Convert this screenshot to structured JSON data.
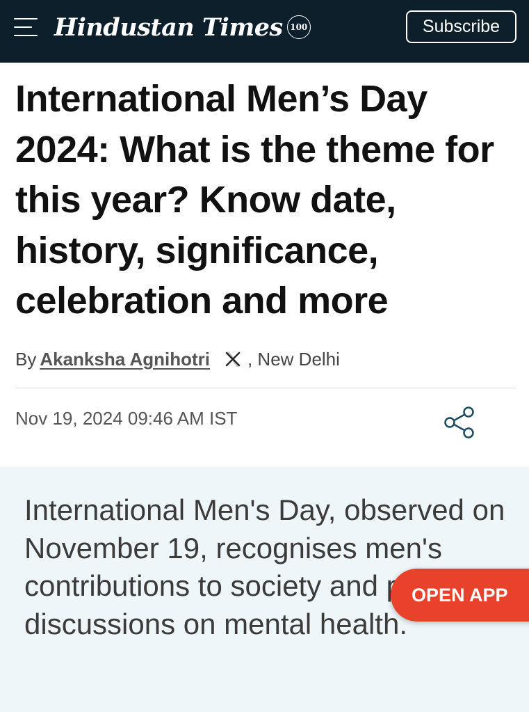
{
  "header": {
    "logo_text": "Hindustan Times",
    "logo_badge": "100",
    "subscribe_label": "Subscribe"
  },
  "article": {
    "headline": "International Men’s Day 2024: What is the theme for this year? Know date, history, significance, celebration and more",
    "by_label": "By",
    "author": "Akanksha Agnihotri",
    "location": ", New Delhi",
    "timestamp": "Nov 19, 2024 09:46 AM IST",
    "summary": "International Men's Day, observed on November 19, recognises men's contributions to society and promotes discussions on mental health."
  },
  "open_app_label": "OPEN APP",
  "icons": {
    "menu": "hamburger-menu-icon",
    "social": "x-twitter-icon",
    "share": "share-icon"
  },
  "colors": {
    "header_bg": "#0c1f2b",
    "summary_bg": "#eef6fa",
    "open_app_bg": "#e8412c"
  }
}
